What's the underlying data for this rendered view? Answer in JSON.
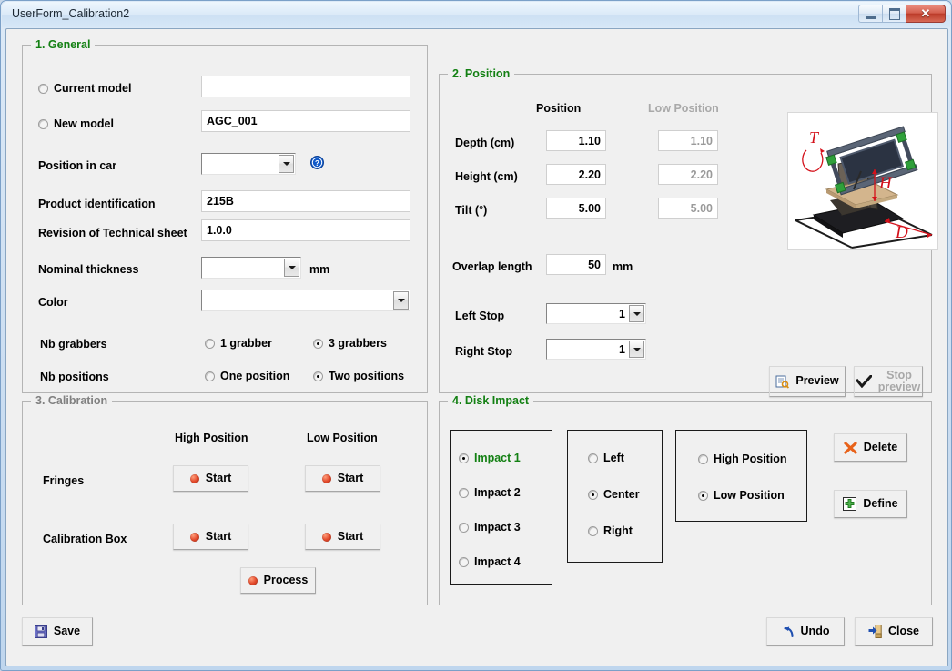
{
  "window": {
    "title": "UserForm_Calibration2",
    "buttons": {
      "minimize": "minimize-button",
      "maximize": "maximize-button",
      "close": "✕"
    }
  },
  "general": {
    "legend": "1. General",
    "current_model": {
      "label": "Current model",
      "selected": false,
      "value": ""
    },
    "new_model": {
      "label": "New model",
      "selected": false,
      "value": "AGC_001"
    },
    "position_in_car": {
      "label": "Position in car",
      "value": ""
    },
    "product_identification": {
      "label": "Product identification",
      "value": "215B"
    },
    "revision": {
      "label": "Revision of Technical sheet",
      "value": "1.0.0"
    },
    "nominal_thickness": {
      "label": "Nominal thickness",
      "value": "",
      "unit": "mm"
    },
    "color": {
      "label": "Color",
      "value": ""
    },
    "nb_grabbers": {
      "label": "Nb grabbers",
      "options": [
        {
          "label": "1 grabber",
          "selected": false
        },
        {
          "label": "3 grabbers",
          "selected": true
        }
      ]
    },
    "nb_positions": {
      "label": "Nb positions",
      "options": [
        {
          "label": "One position",
          "selected": false
        },
        {
          "label": "Two positions",
          "selected": true
        }
      ]
    }
  },
  "position": {
    "legend": "2. Position",
    "col_position": "Position",
    "col_low_position": "Low Position",
    "rows": [
      {
        "label": "Depth (cm)",
        "position": "1.10",
        "low_position": "1.10"
      },
      {
        "label": "Height (cm)",
        "position": "2.20",
        "low_position": "2.20"
      },
      {
        "label": "Tilt (°)",
        "position": "5.00",
        "low_position": "5.00"
      }
    ],
    "overlap": {
      "label": "Overlap length",
      "value": "50",
      "unit": "mm"
    },
    "left_stop": {
      "label": "Left Stop",
      "value": "1"
    },
    "right_stop": {
      "label": "Right Stop",
      "value": "1"
    },
    "preview_button": "Preview",
    "stop_preview_button": "Stop\npreview",
    "diagram_labels": {
      "tilt": "T",
      "height": "H",
      "depth": "D"
    }
  },
  "calibration": {
    "legend": "3. Calibration",
    "col_high_position": "High Position",
    "col_low_position": "Low Position",
    "rows": [
      {
        "label": "Fringes",
        "high_button": "Start",
        "low_button": "Start"
      },
      {
        "label": "Calibration Box",
        "high_button": "Start",
        "low_button": "Start"
      }
    ],
    "process_button": "Process"
  },
  "disk_impact": {
    "legend": "4. Disk Impact",
    "impacts": [
      {
        "label": "Impact 1",
        "selected": true
      },
      {
        "label": "Impact 2",
        "selected": false
      },
      {
        "label": "Impact 3",
        "selected": false
      },
      {
        "label": "Impact 4",
        "selected": false
      }
    ],
    "sides": [
      {
        "label": "Left",
        "selected": false
      },
      {
        "label": "Center",
        "selected": true
      },
      {
        "label": "Right",
        "selected": false
      }
    ],
    "positions": [
      {
        "label": "High Position",
        "selected": false
      },
      {
        "label": "Low Position",
        "selected": true
      }
    ],
    "delete_button": "Delete",
    "define_button": "Define"
  },
  "footer": {
    "save_button": "Save",
    "undo_button": "Undo",
    "close_button": "Close"
  },
  "colors": {
    "legend_green": "#138013",
    "legend_disabled": "#808080",
    "form_background": "#f0f0f0",
    "titlebar": "#dbeaf8",
    "close_red": "#bb3a28",
    "led_red": "#e2482a",
    "accent_selected_text": "#138013"
  }
}
